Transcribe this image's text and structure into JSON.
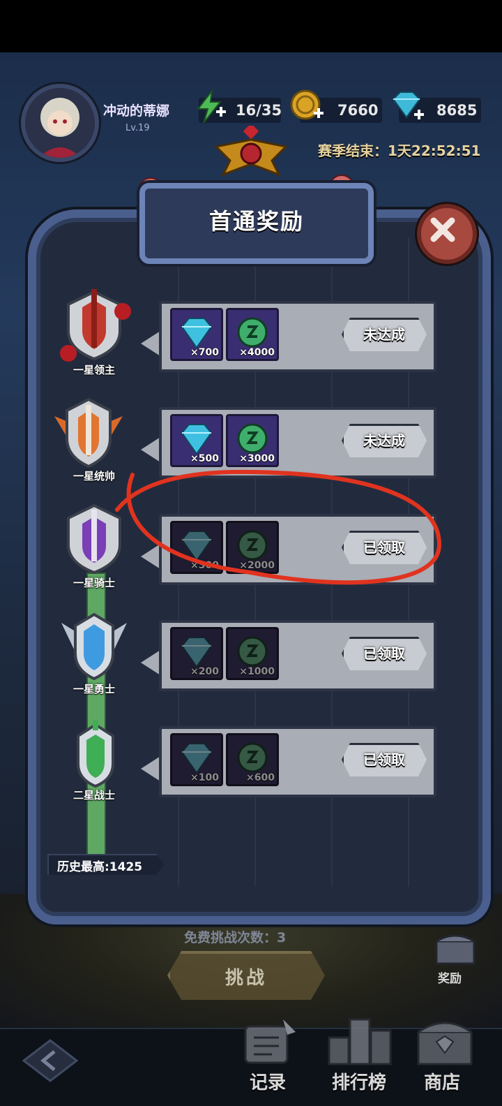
{
  "header": {
    "player_name": "冲动的蒂娜",
    "player_level": "Lv.19",
    "energy": "16/35",
    "gold": "7660",
    "gems": "8685",
    "season_end": "赛季结束：1天22:52:51"
  },
  "panel": {
    "title": "首通奖励"
  },
  "rewards": [
    {
      "rank": "一星领主",
      "gem_qty": "×700",
      "coin_qty": "×4000",
      "status": "未达成"
    },
    {
      "rank": "一星统帅",
      "gem_qty": "×500",
      "coin_qty": "×3000",
      "status": "未达成"
    },
    {
      "rank": "一星骑士",
      "gem_qty": "×300",
      "coin_qty": "×2000",
      "status": "已领取"
    },
    {
      "rank": "一星勇士",
      "gem_qty": "×200",
      "coin_qty": "×1000",
      "status": "已领取"
    },
    {
      "rank": "二星战士",
      "gem_qty": "×100",
      "coin_qty": "×600",
      "status": "已领取"
    }
  ],
  "history_best": "历史最高:1425",
  "footer": {
    "free_attempts": "免费挑战次数：3",
    "challenge": "挑战",
    "reward": "奖励"
  },
  "nav": {
    "records": "记录",
    "leaderboard": "排行榜",
    "shop": "商店"
  },
  "colors": {
    "frame": "#4a5f8d",
    "row": "#a9adb5",
    "annotation": "#e0331f"
  }
}
